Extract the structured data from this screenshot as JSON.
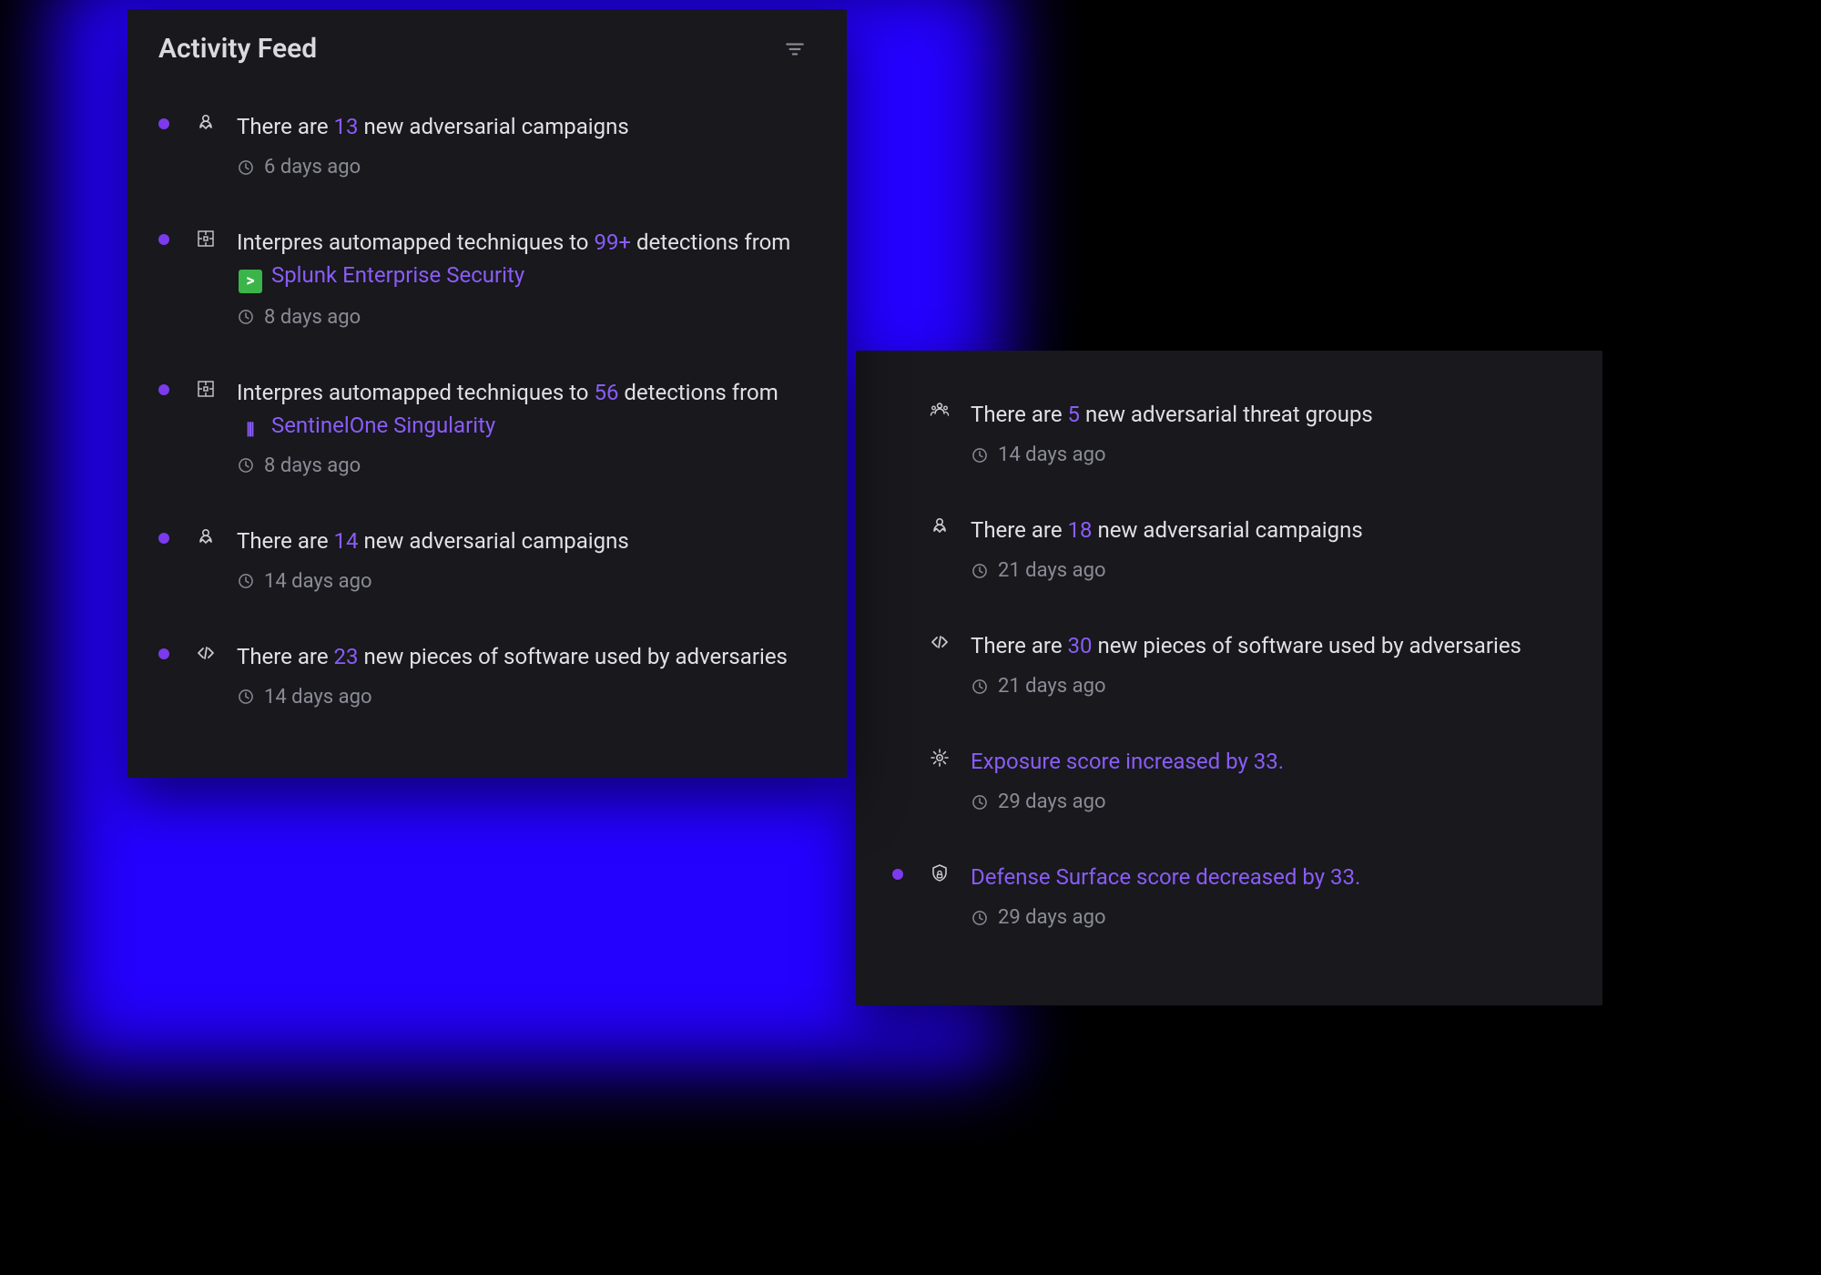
{
  "header": {
    "title": "Activity Feed"
  },
  "left": [
    {
      "bullet": true,
      "icon": "campaign-icon",
      "parts": [
        {
          "t": "There are "
        },
        {
          "t": "13",
          "cls": "num"
        },
        {
          "t": " new adversarial campaigns"
        }
      ],
      "time": "6 days ago"
    },
    {
      "bullet": true,
      "icon": "automap-icon",
      "parts": [
        {
          "t": "Interpres automapped techniques to "
        },
        {
          "t": "99+",
          "cls": "num"
        },
        {
          "t": " detections from "
        },
        {
          "badge": "splunk"
        },
        {
          "t": "Splunk Enterprise Security",
          "cls": "link"
        }
      ],
      "time": "8 days ago"
    },
    {
      "bullet": true,
      "icon": "automap-icon",
      "parts": [
        {
          "t": "Interpres automapped techniques to "
        },
        {
          "t": "56",
          "cls": "num"
        },
        {
          "t": " detections from "
        },
        {
          "badge": "sentinel"
        },
        {
          "t": "SentinelOne Singularity",
          "cls": "link"
        }
      ],
      "time": "8 days ago"
    },
    {
      "bullet": true,
      "icon": "campaign-icon",
      "parts": [
        {
          "t": "There are "
        },
        {
          "t": "14",
          "cls": "num"
        },
        {
          "t": " new adversarial campaigns"
        }
      ],
      "time": "14 days ago"
    },
    {
      "bullet": true,
      "icon": "code-icon",
      "parts": [
        {
          "t": "There are "
        },
        {
          "t": "23",
          "cls": "num"
        },
        {
          "t": " new pieces of software used by adversaries"
        }
      ],
      "time": "14 days ago"
    }
  ],
  "right": [
    {
      "bullet": false,
      "icon": "threat-group-icon",
      "parts": [
        {
          "t": "There are "
        },
        {
          "t": "5",
          "cls": "num"
        },
        {
          "t": " new adversarial threat groups"
        }
      ],
      "time": "14 days ago"
    },
    {
      "bullet": false,
      "icon": "campaign-icon",
      "parts": [
        {
          "t": "There are "
        },
        {
          "t": "18",
          "cls": "num"
        },
        {
          "t": " new adversarial campaigns"
        }
      ],
      "time": "21 days ago"
    },
    {
      "bullet": false,
      "icon": "code-icon",
      "parts": [
        {
          "t": "There are "
        },
        {
          "t": "30",
          "cls": "num"
        },
        {
          "t": " new pieces of software used by adversaries"
        }
      ],
      "time": "21 days ago"
    },
    {
      "bullet": false,
      "icon": "exposure-icon",
      "allLink": true,
      "parts": [
        {
          "t": "Exposure score increased by 33."
        }
      ],
      "time": "29 days ago"
    },
    {
      "bullet": true,
      "icon": "defense-icon",
      "allLink": true,
      "parts": [
        {
          "t": "Defense Surface score decreased by 33."
        }
      ],
      "time": "29 days ago"
    }
  ]
}
